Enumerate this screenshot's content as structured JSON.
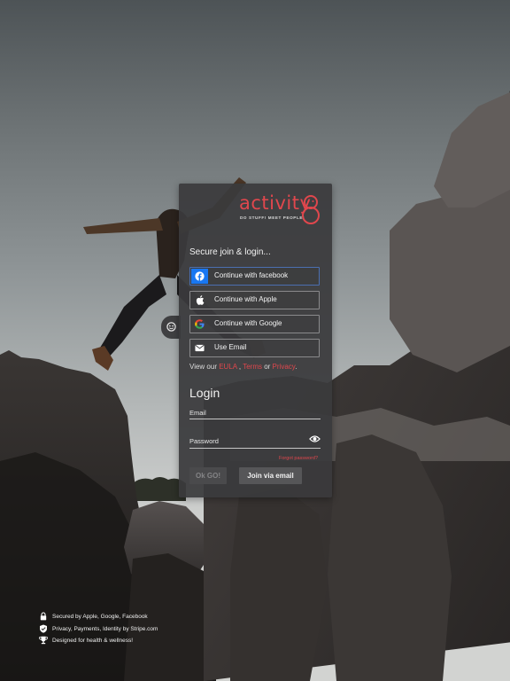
{
  "brand": {
    "name": "activity",
    "tagline": "DO STUFF! MEET PEOPLE!",
    "accent_color": "#e0474d"
  },
  "join": {
    "headline": "Secure join & login...",
    "buttons": [
      {
        "label": "Continue with facebook",
        "icon": "facebook-icon"
      },
      {
        "label": "Continue with Apple",
        "icon": "apple-icon"
      },
      {
        "label": "Continue with Google",
        "icon": "google-icon"
      },
      {
        "label": "Use Email",
        "icon": "mail-icon"
      }
    ],
    "legal": {
      "prefix": "View our ",
      "eula": "EULA",
      "sep1": " , ",
      "terms": "Terms",
      "sep2": " or ",
      "privacy": "Privacy",
      "suffix": "."
    }
  },
  "login": {
    "title": "Login",
    "email_label": "Email",
    "password_label": "Password",
    "forgot": "Forgot password?",
    "ok_button": "Ok GO!",
    "join_button": "Join via email"
  },
  "footer": {
    "notes": [
      {
        "text": "Secured by Apple, Google, Facebook",
        "icon": "lock-icon"
      },
      {
        "text": "Privacy, Payments, Identity by Stripe.com",
        "icon": "shield-check-icon"
      },
      {
        "text": "Designed for health & wellness!",
        "icon": "trophy-icon"
      }
    ]
  }
}
